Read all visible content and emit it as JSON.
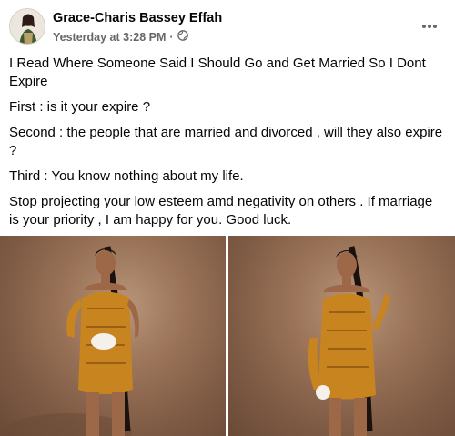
{
  "post": {
    "author": "Grace-Charis Bassey Effah",
    "timestamp": "Yesterday at 3:28 PM",
    "separator": "·",
    "privacy_icon": "globe-icon",
    "more_icon": "more-options-icon",
    "paragraphs": [
      "I Read Where Someone Said I Should Go and Get Married So I Dont Expire",
      "First : is it your expire ?",
      "Second : the people that are married and divorced , will they also expire ?",
      "Third : You know nothing about my life.",
      "Stop projecting your low esteem amd negativity on others . If marriage is your priority , I am happy for you. Good luck."
    ]
  },
  "colors": {
    "text_primary": "#050505",
    "text_secondary": "#65676b",
    "dress_gold": "#c8841f",
    "backdrop_brown": "#9a7358"
  }
}
